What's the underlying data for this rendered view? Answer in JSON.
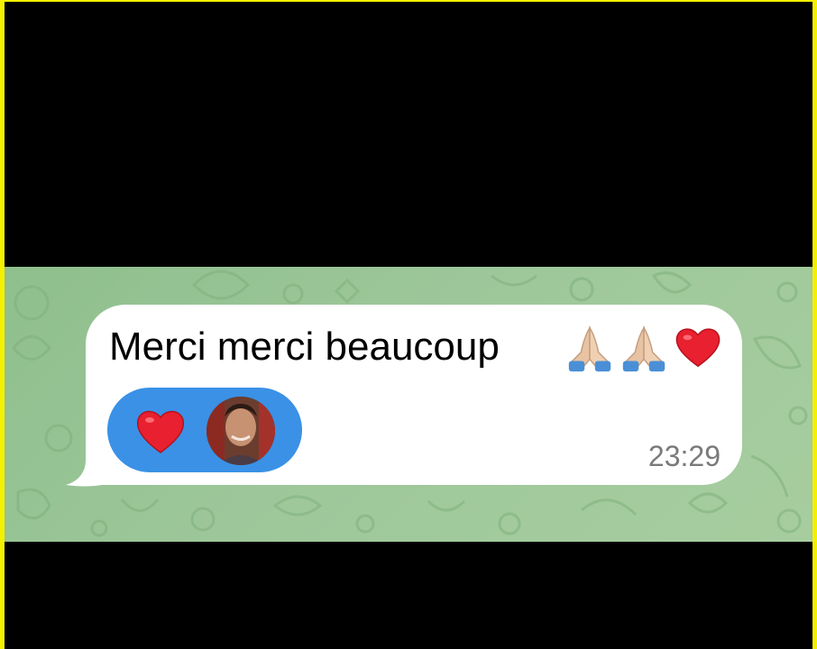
{
  "message": {
    "text": "Merci merci beaucoup",
    "trailing_emojis": [
      "folded-hands-icon",
      "folded-hands-icon",
      "red-heart-icon"
    ],
    "time": "23:29"
  },
  "reaction": {
    "emoji": "red-heart-icon",
    "reactor_avatar": "avatar"
  },
  "colors": {
    "chat_background": "#9dc79a",
    "bubble": "#ffffff",
    "reaction_pill": "#3a91e6",
    "heart": "#e8202f",
    "frame_edge": "#f4f000"
  }
}
